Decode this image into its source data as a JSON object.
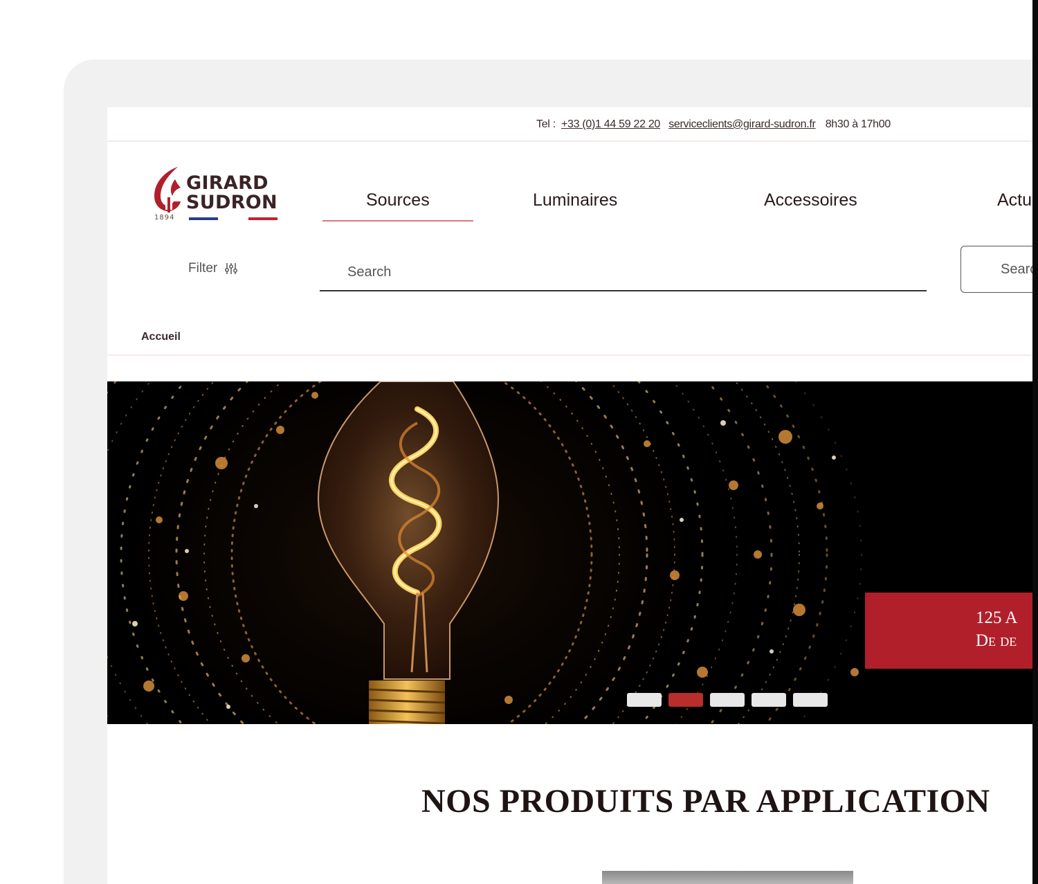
{
  "contact": {
    "tel_label": "Tel :",
    "tel": "+33 (0)1 44 59 22 20",
    "email": "serviceclients@girard-sudron.fr",
    "hours": "8h30 à 17h00"
  },
  "logo": {
    "line1": "GIRARD",
    "line2": "SUDRON",
    "year": "1894"
  },
  "nav": {
    "items": [
      {
        "label": "Sources",
        "active": true
      },
      {
        "label": "Luminaires"
      },
      {
        "label": "Accessoires"
      },
      {
        "label": "Actu"
      }
    ]
  },
  "filter": {
    "label": "Filter"
  },
  "search": {
    "placeholder": "Search",
    "button_label": "Search"
  },
  "breadcrumb": {
    "home": "Accueil"
  },
  "hero": {
    "caption_line1": "125 A",
    "caption_line2": "De de",
    "slides_count": 5,
    "active_slide": 2,
    "accent_color": "#b11f2b"
  },
  "section": {
    "title": "NOS PRODUITS PAR APPLICATION"
  }
}
